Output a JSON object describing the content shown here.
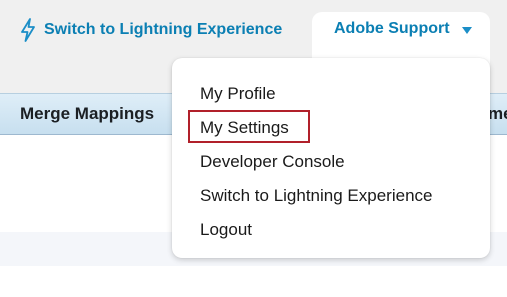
{
  "header": {
    "lightning_link": "Switch to Lightning Experience",
    "user_name": "Adobe Support"
  },
  "tabs": {
    "merge_mappings": "Merge Mappings",
    "partial_tab": "me"
  },
  "menu": {
    "items": [
      {
        "label": "My Profile"
      },
      {
        "label": "My Settings",
        "highlighted": true
      },
      {
        "label": "Developer Console"
      },
      {
        "label": "Switch to Lightning Experience"
      },
      {
        "label": "Logout"
      }
    ]
  },
  "colors": {
    "link": "#0b7fb3",
    "highlight_border": "#b1202a",
    "header_bg": "#f0f0f0",
    "tabbar_bg": "#c7dfef"
  },
  "icons": {
    "lightning": "lightning-bolt-icon",
    "caret": "chevron-down-icon"
  }
}
